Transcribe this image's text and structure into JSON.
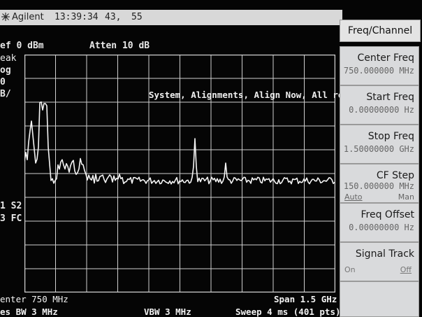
{
  "header": {
    "brand": "Agilent",
    "time": "13:39:34",
    "num1": "43,",
    "num2": "55"
  },
  "left_panel": {
    "ref": "ef 0 dBm",
    "atten": "Atten 10 dB",
    "peak": "eak",
    "log": "og",
    "scale": "0",
    "unit": "B/",
    "s2": "1 S2",
    "fc": "3 FC"
  },
  "message": "System, Alignments, Align Now, All required",
  "footer": {
    "center": "enter 750 MHz",
    "span": "Span 1.5 GHz",
    "res_bw": "es BW 3 MHz",
    "vbw": "VBW 3 MHz",
    "sweep": "Sweep 4 ms (401 pts)"
  },
  "softkeys": {
    "title": "Freq/Channel",
    "center_freq": {
      "label": "Center Freq",
      "value": "750.000000 MHz"
    },
    "start_freq": {
      "label": "Start Freq",
      "value": "0.00000000  Hz"
    },
    "stop_freq": {
      "label": "Stop Freq",
      "value": "1.50000000 GHz"
    },
    "cf_step": {
      "label": "CF Step",
      "value": "150.000000 MHz",
      "auto": "Auto",
      "man": "Man"
    },
    "freq_offset": {
      "label": "Freq Offset",
      "value": "0.00000000  Hz"
    },
    "signal_track": {
      "label": "Signal Track",
      "on": "On",
      "off": "Off"
    }
  },
  "colors": {
    "screen_bg": "#050505",
    "trace": "#f4f4f4",
    "grid": "#d0d0d0",
    "softkey_bg": "#d9dadc"
  }
}
